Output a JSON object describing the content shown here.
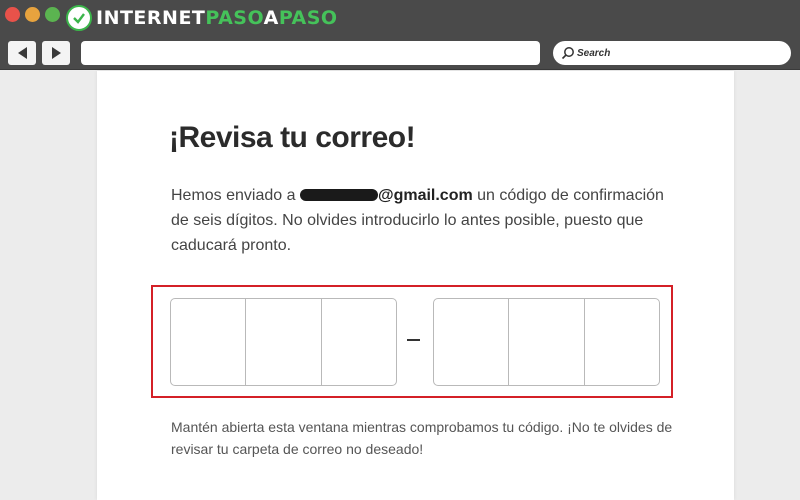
{
  "window": {
    "brand_prefix": "INTERNET",
    "brand_accent1": "PASO",
    "brand_mid": "A",
    "brand_accent2": "PASO"
  },
  "toolbar": {
    "search_placeholder": "Search",
    "url_value": ""
  },
  "page": {
    "title": "¡Revisa tu correo!",
    "intro_prefix": "Hemos enviado a ",
    "email_domain": "@gmail.com",
    "intro_suffix": " un código de confirmación de seis dígitos. No olvides introducirlo lo antes posible, puesto que caducará pronto.",
    "code_separator": "–",
    "footer": "Mantén abierta esta ventana mientras comprobamos tu código. ¡No te olvides de revisar tu carpeta de correo no deseado!"
  },
  "colors": {
    "chrome": "#4a4a4a",
    "highlight_border": "#d42027",
    "brand_accent": "#45c25a"
  },
  "icons": [
    "close-dot-icon",
    "minimize-dot-icon",
    "maximize-dot-icon",
    "back-arrow-icon",
    "forward-arrow-icon",
    "search-icon"
  ]
}
